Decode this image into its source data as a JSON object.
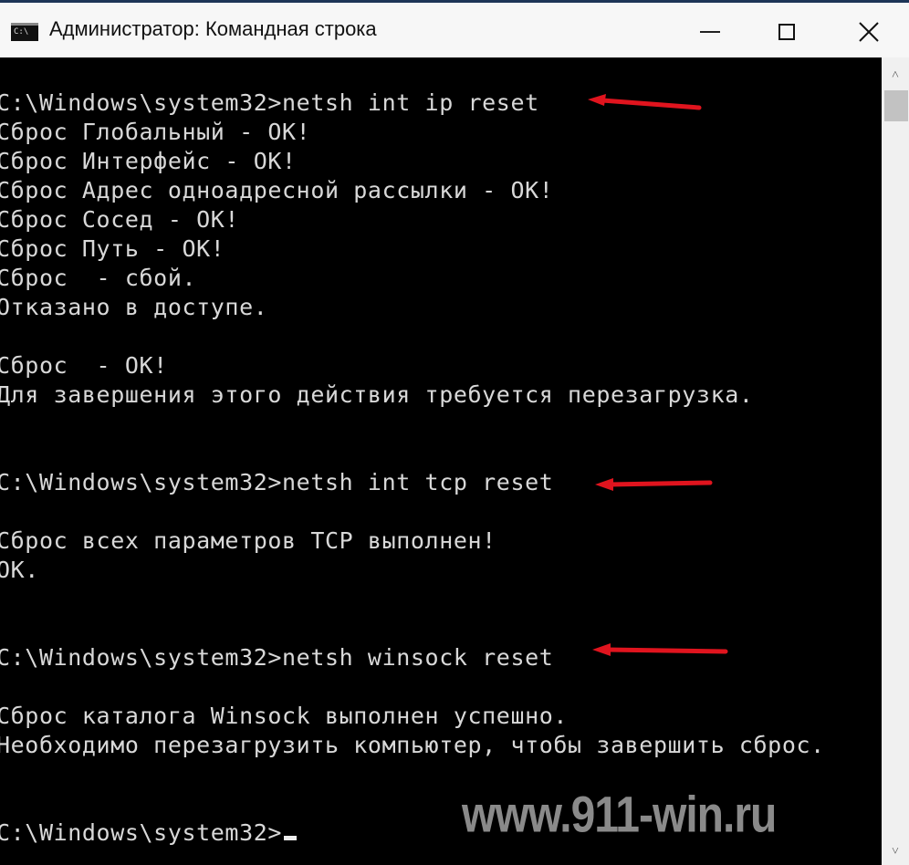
{
  "window": {
    "title": "Администратор: Командная строка",
    "icon_text": "C:\\",
    "icon": "console-icon",
    "controls": {
      "minimize": "minimize-icon",
      "maximize": "maximize-icon",
      "close": "close-icon"
    }
  },
  "console": {
    "lines": [
      "C:\\Windows\\system32>netsh int ip reset",
      "Сброс Глобальный - ОК!",
      "Сброс Интерфейс - ОК!",
      "Сброс Адрес одноадресной рассылки - ОК!",
      "Сброс Сосед - ОК!",
      "Сброс Путь - ОК!",
      "Сброс  - сбой.",
      "Отказано в доступе.",
      "",
      "Сброс  - ОК!",
      "Для завершения этого действия требуется перезагрузка.",
      "",
      "",
      "C:\\Windows\\system32>netsh int tcp reset",
      "",
      "Сброс всех параметров TCP выполнен!",
      "ОК.",
      "",
      "",
      "C:\\Windows\\system32>netsh winsock reset",
      "",
      "Сброс каталога Winsock выполнен успешно.",
      "Необходимо перезагрузить компьютер, чтобы завершить сброс.",
      "",
      "",
      "C:\\Windows\\system32>"
    ],
    "annotation_color": "#e0141e",
    "annotation_icon": "red-arrow-icon"
  },
  "watermark": "www.911-win.ru",
  "scrollbar": {
    "up_icon": "chevron-up-icon",
    "down_icon": "chevron-down-icon"
  }
}
